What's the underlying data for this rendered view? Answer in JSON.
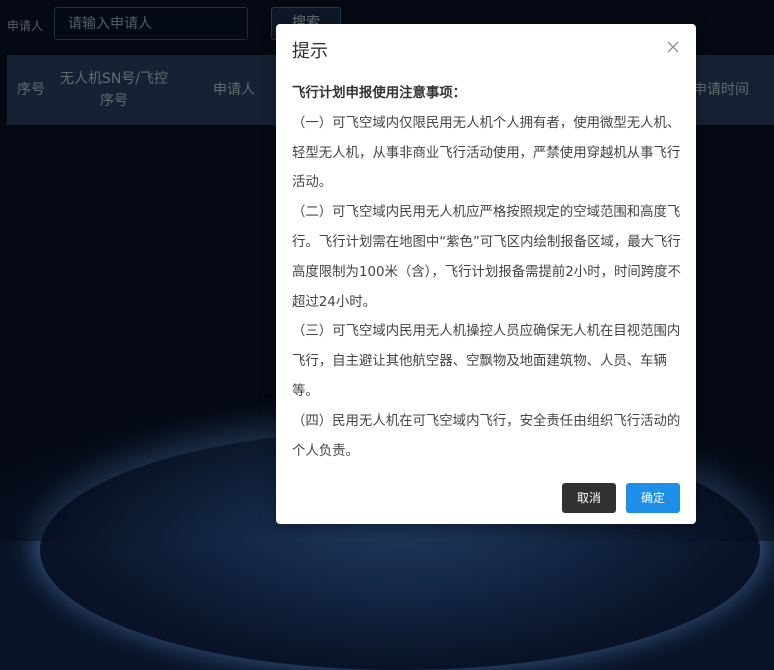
{
  "search": {
    "label": "申请人",
    "placeholder": "请输入申请人",
    "button_label": "搜索"
  },
  "table": {
    "headers": {
      "index": "序号",
      "sn": "无人机SN号/飞控序号",
      "applicant": "申请人",
      "time": "申请时间"
    }
  },
  "dialog": {
    "title": "提示",
    "heading": "飞行计划申报使用注意事项：",
    "items": [
      "（一）可飞空域内仅限民用无人机个人拥有者，使用微型无人机、轻型无人机，从事非商业飞行活动使用，严禁使用穿越机从事飞行活动。",
      "（二）可飞空域内民用无人机应严格按照规定的空域范围和高度飞行。飞行计划需在地图中“紫色”可飞区内绘制报备区域，最大飞行高度限制为100米（含），飞行计划报备需提前2小时，时间跨度不超过24小时。",
      "（三）可飞空域内民用无人机操控人员应确保无人机在目视范围内飞行，自主避让其他航空器、空飘物及地面建筑物、人员、车辆等。",
      "（四）民用无人机在可飞空域内飞行，安全责任由组织飞行活动的个人负责。"
    ],
    "cancel_label": "取消",
    "confirm_label": "确定"
  },
  "colors": {
    "confirm": "#1d8fe8",
    "cancel": "#303133",
    "table_header": "#2c4466"
  }
}
